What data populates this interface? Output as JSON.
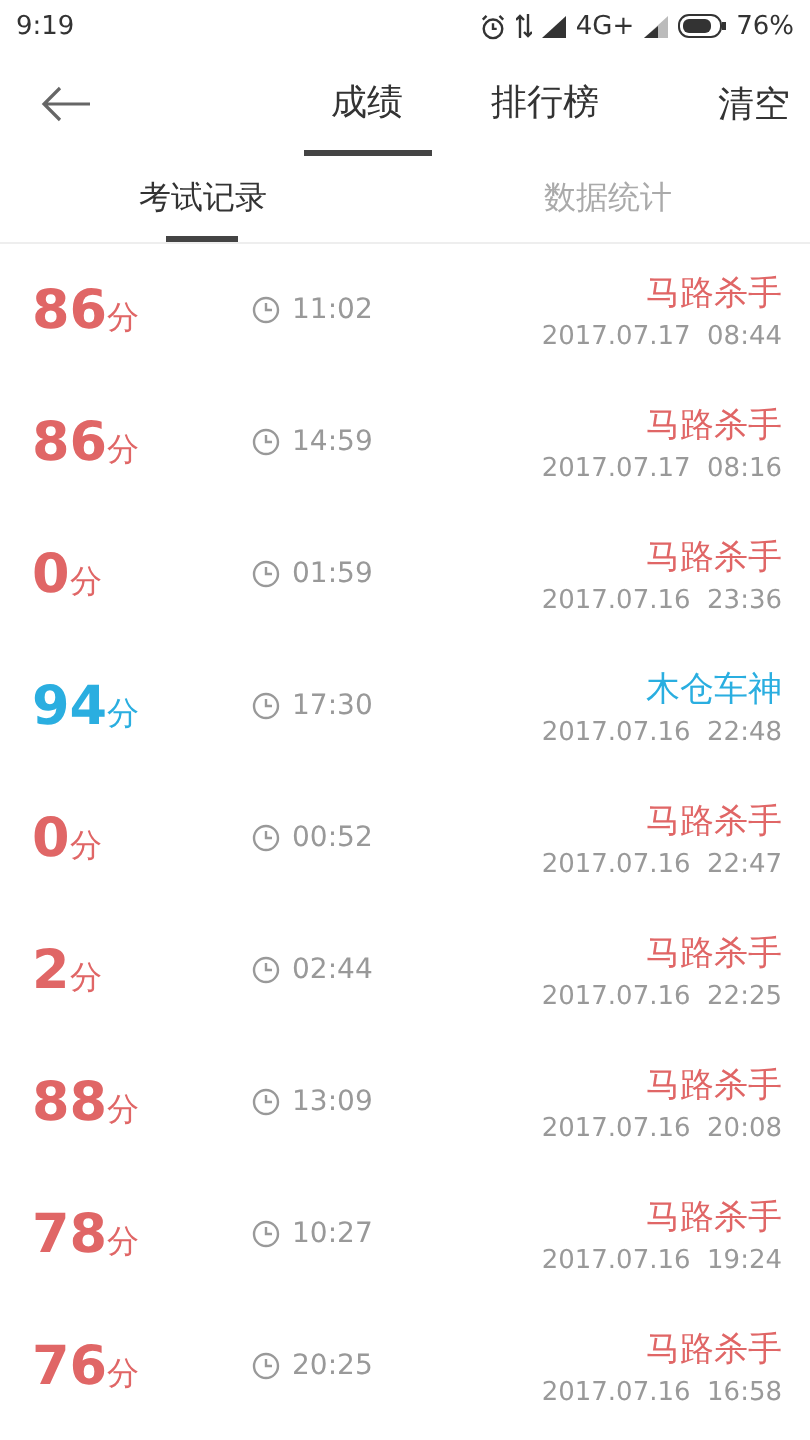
{
  "status_bar": {
    "time": "9:19",
    "network": "4G+",
    "battery": "76%"
  },
  "header": {
    "tabs": [
      {
        "label": "成绩",
        "selected": true
      },
      {
        "label": "排行榜",
        "selected": false
      }
    ],
    "action": "清空"
  },
  "subtabs": [
    {
      "label": "考试记录",
      "selected": true
    },
    {
      "label": "数据统计",
      "selected": false
    }
  ],
  "records": [
    {
      "score": "86",
      "unit": "分",
      "duration": "11:02",
      "title": "马路杀手",
      "date": "2017.07.17  08:44",
      "color": "#e06666"
    },
    {
      "score": "86",
      "unit": "分",
      "duration": "14:59",
      "title": "马路杀手",
      "date": "2017.07.17  08:16",
      "color": "#e06666"
    },
    {
      "score": "0",
      "unit": "分",
      "duration": "01:59",
      "title": "马路杀手",
      "date": "2017.07.16  23:36",
      "color": "#e06666"
    },
    {
      "score": "94",
      "unit": "分",
      "duration": "17:30",
      "title": "木仓车神",
      "date": "2017.07.16  22:48",
      "color": "#2aaee0"
    },
    {
      "score": "0",
      "unit": "分",
      "duration": "00:52",
      "title": "马路杀手",
      "date": "2017.07.16  22:47",
      "color": "#e06666"
    },
    {
      "score": "2",
      "unit": "分",
      "duration": "02:44",
      "title": "马路杀手",
      "date": "2017.07.16  22:25",
      "color": "#e06666"
    },
    {
      "score": "88",
      "unit": "分",
      "duration": "13:09",
      "title": "马路杀手",
      "date": "2017.07.16  20:08",
      "color": "#e06666"
    },
    {
      "score": "78",
      "unit": "分",
      "duration": "10:27",
      "title": "马路杀手",
      "date": "2017.07.16  19:24",
      "color": "#e06666"
    },
    {
      "score": "76",
      "unit": "分",
      "duration": "20:25",
      "title": "马路杀手",
      "date": "2017.07.16  16:58",
      "color": "#e06666"
    }
  ]
}
